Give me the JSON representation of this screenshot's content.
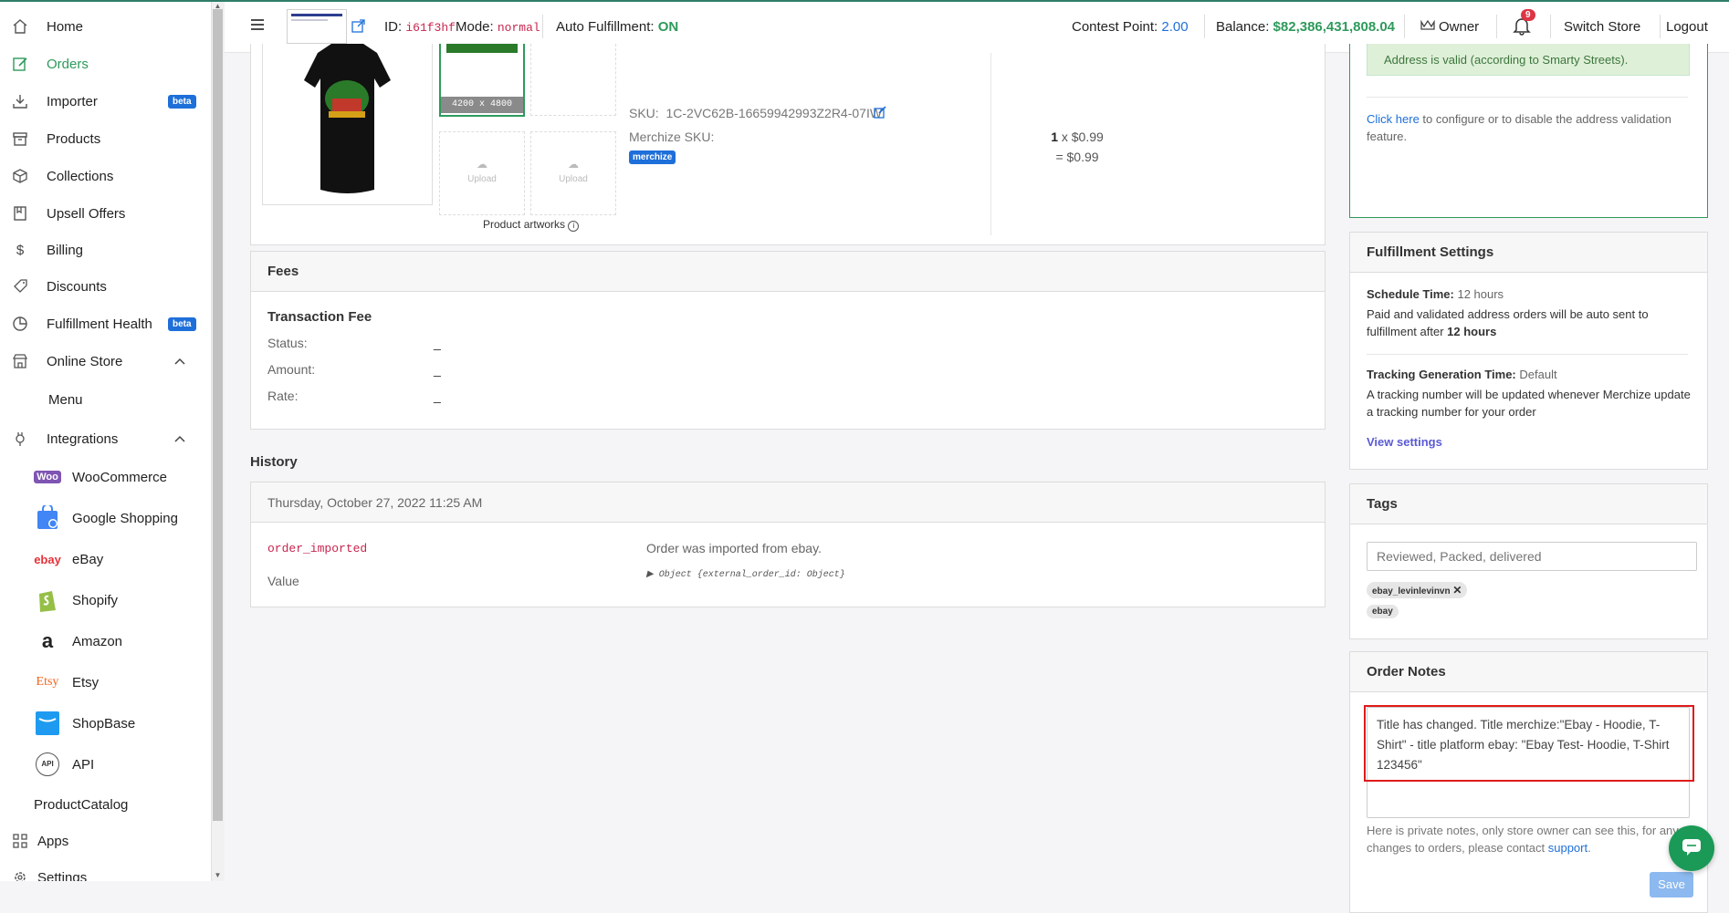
{
  "sidebar": {
    "items": [
      {
        "label": "Home",
        "icon": "home-icon"
      },
      {
        "label": "Orders",
        "icon": "edit-icon"
      },
      {
        "label": "Importer",
        "icon": "download-icon",
        "badge": "beta"
      },
      {
        "label": "Products",
        "icon": "box-icon"
      },
      {
        "label": "Collections",
        "icon": "cube-icon"
      },
      {
        "label": "Upsell Offers",
        "icon": "book-icon"
      },
      {
        "label": "Billing",
        "icon": "dollar-icon"
      },
      {
        "label": "Discounts",
        "icon": "tag-icon"
      },
      {
        "label": "Fulfillment Health",
        "icon": "pie-chart-icon",
        "badge": "beta"
      },
      {
        "label": "Online Store",
        "icon": "store-icon"
      },
      {
        "label": "Menu"
      },
      {
        "label": "Integrations",
        "icon": "plug-icon"
      }
    ],
    "integrations": [
      {
        "label": "WooCommerce",
        "icon": "woocommerce-logo"
      },
      {
        "label": "Google Shopping",
        "icon": "google-shopping-logo"
      },
      {
        "label": "eBay",
        "icon": "ebay-logo"
      },
      {
        "label": "Shopify",
        "icon": "shopify-logo"
      },
      {
        "label": "Amazon",
        "icon": "amazon-logo"
      },
      {
        "label": "Etsy",
        "icon": "etsy-logo"
      },
      {
        "label": "ShopBase",
        "icon": "shopbase-logo"
      },
      {
        "label": "API",
        "icon": "api-logo"
      }
    ],
    "bottom": [
      {
        "label": "ProductCatalog",
        "icon": "catalog-icon"
      },
      {
        "label": "Apps",
        "icon": "grid-icon"
      },
      {
        "label": "Settings",
        "icon": "gear-icon"
      }
    ],
    "logo_texts": {
      "woo": "Woo",
      "ebay": "ebay",
      "etsy": "Etsy",
      "amazon": "a",
      "api": "API"
    }
  },
  "header": {
    "id_label": "ID:",
    "id_value": "i61f3hf",
    "mode_label": "Mode:",
    "mode_value": "normal",
    "auto_label": "Auto Fulfillment:",
    "auto_value": "ON",
    "contest_label": "Contest Point:",
    "contest_value": "2.00",
    "balance_label": "Balance:",
    "balance_value": "$82,386,431,808.04",
    "owner": "Owner",
    "notif_count": "9",
    "switch_store": "Switch Store",
    "logout": "Logout"
  },
  "product": {
    "artwork_size": "4200 x 4800",
    "upload": "Upload",
    "artworks_label": "Product artworks",
    "sku_label": "SKU:",
    "sku_value": "1C-2VC62B-16659942993Z2R4-07IW",
    "merchize_sku_label": "Merchize SKU:",
    "merchize_badge": "merchize",
    "qty": "1",
    "unit": "x $0.99",
    "total": "= $0.99"
  },
  "fees": {
    "title": "Fees",
    "subtitle": "Transaction Fee",
    "rows": [
      {
        "label": "Status:",
        "value": "_"
      },
      {
        "label": "Amount:",
        "value": "_"
      },
      {
        "label": "Rate:",
        "value": "_"
      }
    ]
  },
  "history": {
    "title": "History",
    "date": "Thursday, October 27, 2022 11:25 AM",
    "event": "order_imported",
    "event_desc": "Order was imported from ebay.",
    "value_label": "Value",
    "value_obj": "▶ Object {external_order_id: Object}"
  },
  "address": {
    "valid_text": "Address is valid (according to Smarty Streets).",
    "click_here": "Click here",
    "config_text": " to configure or to disable the address validation feature."
  },
  "fulfillment": {
    "title": "Fulfillment Settings",
    "schedule_label": "Schedule Time:",
    "schedule_value": "12 hours",
    "schedule_desc": "Paid and validated address orders will be auto sent to fulfillment after ",
    "schedule_bold": "12 hours",
    "tracking_label": "Tracking Generation Time:",
    "tracking_value": "Default",
    "tracking_desc": "A tracking number will be updated whenever Merchize update a tracking number for your order",
    "view_settings": "View settings"
  },
  "tags": {
    "title": "Tags",
    "placeholder": "Reviewed, Packed, delivered",
    "items": [
      "ebay_levinlevinvn",
      "ebay"
    ]
  },
  "notes": {
    "title": "Order Notes",
    "text": "Title has changed. Title merchize:\"Ebay -  Hoodie, T-Shirt\" - title platform ebay: \"Ebay Test-  Hoodie, T-Shirt 123456\"",
    "help": "Here is private notes, only store owner can see this, for any changes to orders, please contact ",
    "support": "support",
    "save": "Save"
  }
}
